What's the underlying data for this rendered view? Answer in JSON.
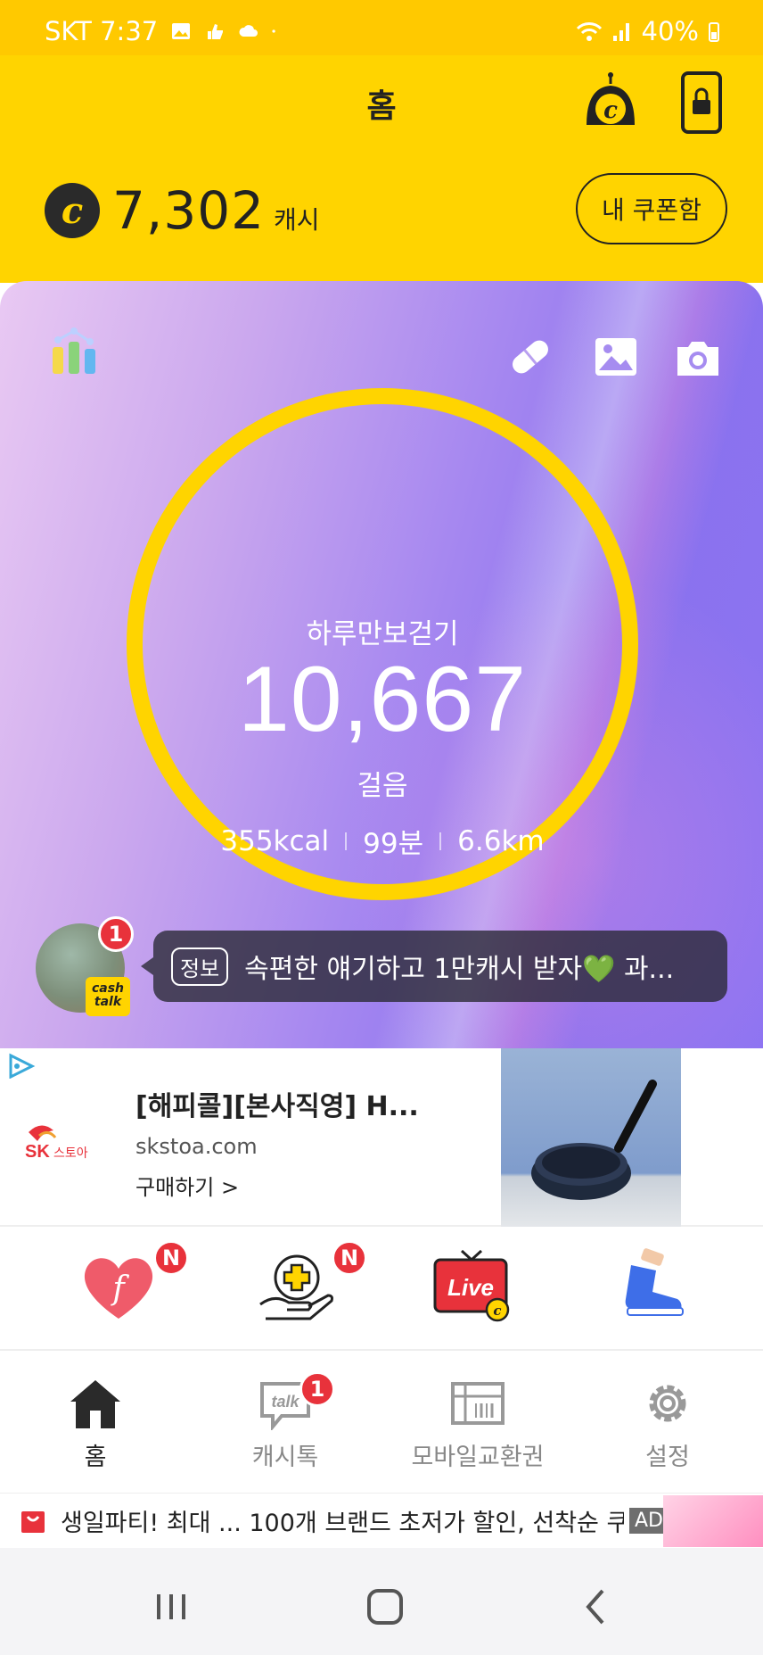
{
  "status_bar": {
    "carrier_time": "SKT 7:37",
    "battery": "40%",
    "icons": [
      "gallery-icon",
      "thumbs-icon",
      "cloud-icon",
      "dot-icon",
      "wifi-icon",
      "signal-icon",
      "battery-icon"
    ]
  },
  "header": {
    "title": "홈",
    "cash_amount": "7,302",
    "cash_unit": "캐시",
    "coupon_label": "내 쿠폰함",
    "coin_symbol": "c",
    "bg_color": "#FFD400"
  },
  "walk_card": {
    "label": "하루만보걷기",
    "steps": "10,667",
    "steps_unit": "걸음",
    "calories": "355kcal",
    "minutes": "99분",
    "distance": "6.6km",
    "ring_color": "#FFD400"
  },
  "cash_talk": {
    "badge_count": "1",
    "badge_label_1": "cash",
    "badge_label_2": "talk",
    "info_tag": "정보",
    "message": "속편한 얘기하고 1만캐시 받자💚 과..."
  },
  "ad": {
    "brand": "SK 스토아",
    "title": "[해피콜][본사직영] H...",
    "domain": "skstoa.com",
    "cta": "구매하기 >"
  },
  "shortcuts": [
    {
      "name": "fundraising-heart-icon",
      "badge": "N"
    },
    {
      "name": "health-plus-icon",
      "badge": "N"
    },
    {
      "name": "live-tv-icon",
      "label": "Live"
    },
    {
      "name": "walking-shoe-icon"
    }
  ],
  "tabs": [
    {
      "label": "홈",
      "active": true
    },
    {
      "label": "캐시톡",
      "badge": "1"
    },
    {
      "label": "모바일교환권"
    },
    {
      "label": "설정"
    }
  ],
  "bottom_ad": {
    "text": "생일파티! 최대 ...  100개 브랜드 초저가 할인, 선착순 쿠...",
    "tag": "AD"
  }
}
